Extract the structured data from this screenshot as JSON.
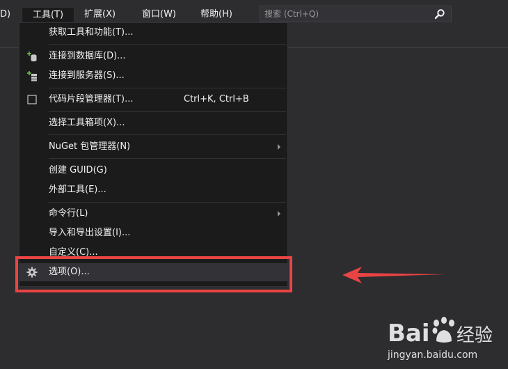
{
  "menubar": {
    "prev_fragment": "D)",
    "items": [
      "工具(T)",
      "扩展(X)",
      "窗口(W)",
      "帮助(H)"
    ],
    "search_placeholder": "搜索 (Ctrl+Q)"
  },
  "dropdown": {
    "items": [
      {
        "label": "获取工具和功能(T)..."
      },
      {
        "label": "连接到数据库(D)..."
      },
      {
        "label": "连接到服务器(S)..."
      },
      {
        "label": "代码片段管理器(T)...",
        "shortcut": "Ctrl+K, Ctrl+B"
      },
      {
        "label": "选择工具箱项(X)..."
      },
      {
        "label": "NuGet 包管理器(N)"
      },
      {
        "label": "创建 GUID(G)"
      },
      {
        "label": "外部工具(E)..."
      },
      {
        "label": "命令行(L)"
      },
      {
        "label": "导入和导出设置(I)..."
      },
      {
        "label": "自定义(C)..."
      },
      {
        "label": "选项(O)..."
      }
    ]
  },
  "watermark": {
    "brand_left": "Bai",
    "brand_right": "经验",
    "url": "jingyan.baidu.com"
  },
  "colors": {
    "highlight": "#e94343",
    "menu_bg": "#1b1b1c",
    "chrome_bg": "#2d2d30"
  }
}
